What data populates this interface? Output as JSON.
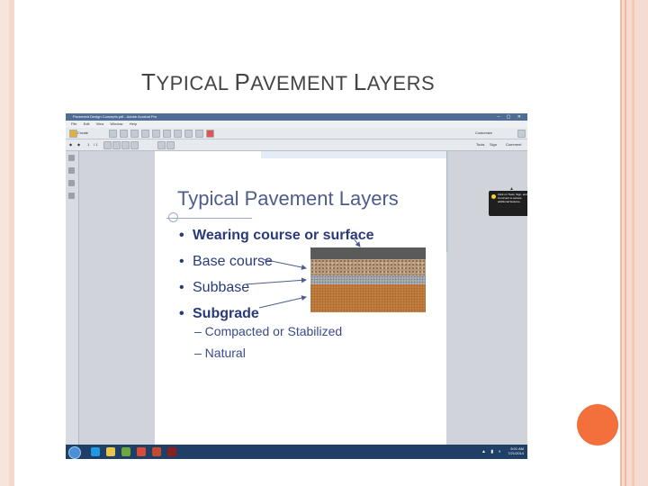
{
  "slide": {
    "title_first_letter_1": "T",
    "title_rest_1": "YPICAL ",
    "title_first_letter_2": "P",
    "title_rest_2": "AVEMENT ",
    "title_first_letter_3": "L",
    "title_rest_3": "AYERS",
    "accent_color": "#f36f3c"
  },
  "screenshot": {
    "window_title": "Pavement Design Concepts.pdf - Adobe Acrobat Pro",
    "window_controls": "– ▢ ✕",
    "menu": [
      "File",
      "Edit",
      "View",
      "Window",
      "Help"
    ],
    "toolbar": {
      "create_label": "Create",
      "customize_label": "Customize",
      "page_number": "1",
      "page_total": "/ 1",
      "zoom": "56.6%"
    },
    "panels": {
      "tools": "Tools",
      "sign": "Sign",
      "comment": "Comment"
    },
    "tooltip_text": "Click on Tools, Sign, and Comment to access additional features.",
    "document": {
      "heading": "Typical Pavement Layers",
      "bullets": [
        {
          "label": "Wearing course or surface",
          "bold": true
        },
        {
          "label": "Base course",
          "bold": false
        },
        {
          "label": "Subbase",
          "bold": false
        },
        {
          "label": "Subgrade",
          "bold": true
        }
      ],
      "subbullets": [
        "– Compacted or Stabilized",
        "– Natural"
      ],
      "bullet_char": "•"
    },
    "taskbar": {
      "time": "8:01 AM",
      "date": "7/21/2014"
    }
  }
}
